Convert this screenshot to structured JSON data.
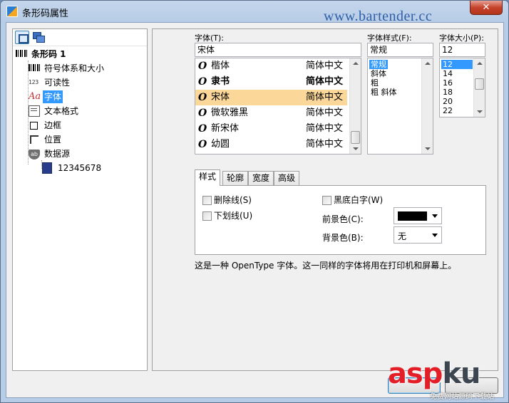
{
  "window": {
    "title": "条形码属性",
    "watermark_url": "www.bartender.cc",
    "close_glyph": "✕"
  },
  "tree": {
    "root": "条形码 1",
    "items": [
      {
        "label": "符号体系和大小",
        "icon": "barcode-icon"
      },
      {
        "label": "可读性",
        "icon": "digits-icon",
        "icon_text": "123"
      },
      {
        "label": "字体",
        "icon": "font-icon",
        "icon_text": "Aa",
        "selected": true
      },
      {
        "label": "文本格式",
        "icon": "text-format-icon"
      },
      {
        "label": "边框",
        "icon": "border-icon"
      },
      {
        "label": "位置",
        "icon": "position-icon"
      },
      {
        "label": "数据源",
        "icon": "datasource-icon",
        "icon_text": "ab"
      }
    ],
    "child": {
      "label": "12345678",
      "icon": "document-icon"
    }
  },
  "font_panel": {
    "font_label": "字体(T):",
    "font_value": "宋体",
    "style_label": "字体样式(F):",
    "style_value": "常规",
    "size_label": "字体大小(P):",
    "size_value": "12",
    "fonts": [
      {
        "name": "楷体",
        "sample": "简体中文"
      },
      {
        "name": "隶书",
        "sample": "简体中文"
      },
      {
        "name": "宋体",
        "sample": "简体中文",
        "selected": true
      },
      {
        "name": "微软雅黑",
        "sample": "简体中文"
      },
      {
        "name": "新宋体",
        "sample": "简体中文"
      },
      {
        "name": "幼圆",
        "sample": "简体中文"
      }
    ],
    "styles": [
      "常规",
      "斜体",
      "粗",
      "粗 斜体"
    ],
    "sizes": [
      "12",
      "14",
      "16",
      "18",
      "20",
      "22"
    ]
  },
  "tabs": [
    "样式",
    "轮廓",
    "宽度",
    "高级"
  ],
  "style_tab": {
    "strikethrough": "删除线(S)",
    "underline": "下划线(U)",
    "inverse": "黑底白字(W)",
    "foreground_label": "前景色(C):",
    "foreground_color": "#000000",
    "background_label": "背景色(B):",
    "background_value": "无"
  },
  "description": "这是一种 OpenType 字体。这一同样的字体将用在打印机和屏幕上。",
  "watermark": {
    "asp": "asp",
    "ku": "ku",
    "sub": "免费网站源码下载站"
  }
}
